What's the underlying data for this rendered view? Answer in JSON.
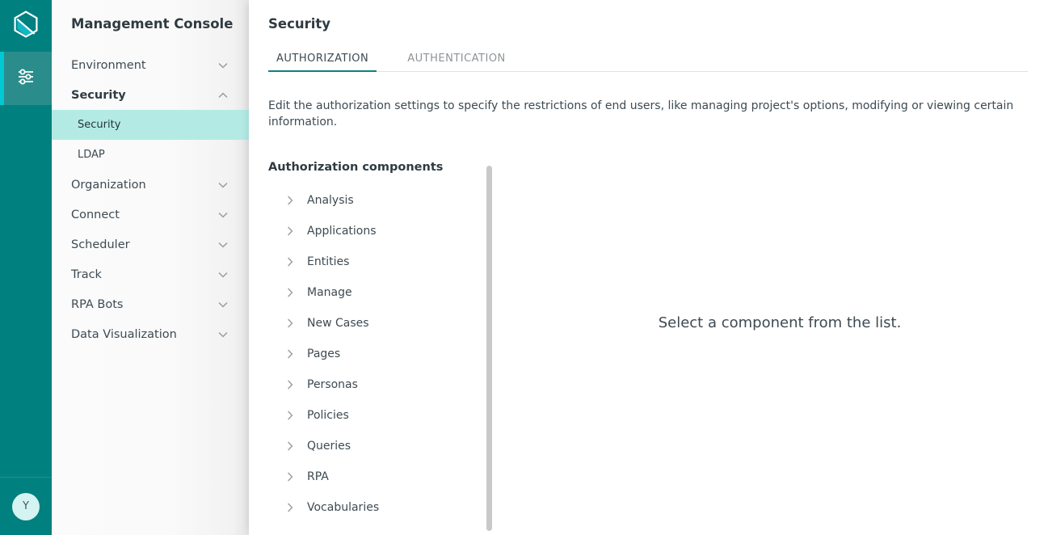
{
  "colors": {
    "rail_bg": "#00807f",
    "rail_active": "#2a8d8b",
    "rail_accent": "#00c8d4",
    "submenu_active": "#b3ebe4",
    "tab_underline": "#0d8282",
    "avatar_bg": "#d4f3f1"
  },
  "rail": {
    "logo_icon": "hexagon-logo-icon",
    "items": [
      {
        "icon": "sliders-settings-icon",
        "name": "settings-rail-item",
        "active": true
      }
    ],
    "avatar_initial": "Y"
  },
  "sidebar": {
    "title": "Management Console",
    "items": [
      {
        "label": "Environment",
        "icon": "chevron-down-icon",
        "expanded": false
      },
      {
        "label": "Security",
        "icon": "chevron-up-icon",
        "expanded": true
      },
      {
        "label": "Organization",
        "icon": "chevron-down-icon",
        "expanded": false
      },
      {
        "label": "Connect",
        "icon": "chevron-down-icon",
        "expanded": false
      },
      {
        "label": "Scheduler",
        "icon": "chevron-down-icon",
        "expanded": false
      },
      {
        "label": "Track",
        "icon": "chevron-down-icon",
        "expanded": false
      },
      {
        "label": "RPA Bots",
        "icon": "chevron-down-icon",
        "expanded": false
      },
      {
        "label": "Data Visualization",
        "icon": "chevron-down-icon",
        "expanded": false
      }
    ],
    "security_submenu": [
      {
        "label": "Security",
        "active": true
      },
      {
        "label": "LDAP",
        "active": false
      }
    ]
  },
  "main": {
    "page_title": "Security",
    "tabs": [
      {
        "label": "AUTHORIZATION",
        "active": true
      },
      {
        "label": "AUTHENTICATION",
        "active": false
      }
    ],
    "description": "Edit the authorization settings to specify the restrictions of end users, like managing project's options, modifying or viewing certain information.",
    "components_title": "Authorization components",
    "components": [
      {
        "label": "Analysis",
        "icon": "chevron-right-icon"
      },
      {
        "label": "Applications",
        "icon": "chevron-right-icon"
      },
      {
        "label": "Entities",
        "icon": "chevron-right-icon"
      },
      {
        "label": "Manage",
        "icon": "chevron-right-icon"
      },
      {
        "label": "New Cases",
        "icon": "chevron-right-icon"
      },
      {
        "label": "Pages",
        "icon": "chevron-right-icon"
      },
      {
        "label": "Personas",
        "icon": "chevron-right-icon"
      },
      {
        "label": "Policies",
        "icon": "chevron-right-icon"
      },
      {
        "label": "Queries",
        "icon": "chevron-right-icon"
      },
      {
        "label": "RPA",
        "icon": "chevron-right-icon"
      },
      {
        "label": "Vocabularies",
        "icon": "chevron-right-icon"
      }
    ],
    "empty_state": "Select a component from the list."
  }
}
